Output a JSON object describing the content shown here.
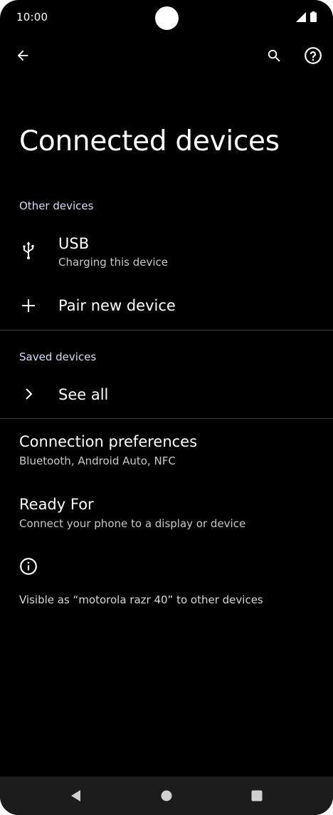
{
  "status_bar": {
    "time": "10:00"
  },
  "app_bar": {
    "back_icon": "arrow-back-icon",
    "search_icon": "search-icon",
    "help_icon": "help-icon"
  },
  "page": {
    "title": "Connected devices"
  },
  "other_devices": {
    "header": "Other devices",
    "usb": {
      "title": "USB",
      "subtitle": "Charging this device",
      "icon": "usb-icon"
    },
    "pair": {
      "title": "Pair new device",
      "icon": "plus-icon"
    }
  },
  "saved_devices": {
    "header": "Saved devices",
    "see_all": {
      "title": "See all",
      "icon": "chevron-right-icon"
    }
  },
  "connection_preferences": {
    "title": "Connection preferences",
    "subtitle": "Bluetooth, Android Auto, NFC"
  },
  "ready_for": {
    "title": "Ready For",
    "subtitle": "Connect your phone to a display or device"
  },
  "footer": {
    "icon": "info-icon",
    "text": "Visible as “motorola razr 40” to other devices"
  },
  "colors": {
    "background": "#000000",
    "section_header": "#d4dcf7",
    "navbar": "#1c1c1c"
  }
}
